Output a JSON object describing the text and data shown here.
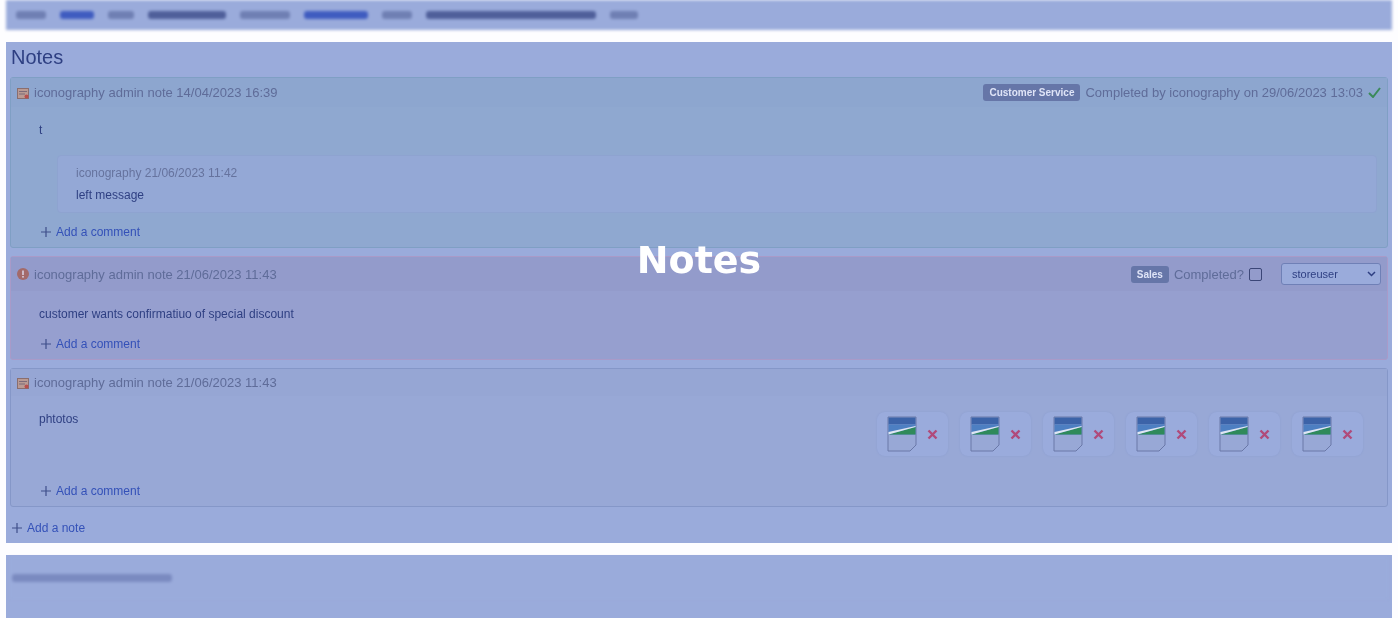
{
  "overlay_label": "Notes",
  "notes_panel": {
    "title": "Notes",
    "add_note": "Add a note",
    "notes": [
      {
        "kind": "note",
        "header": "iconography admin note 14/04/2023 16:39",
        "tag": "Customer Service",
        "completed": true,
        "completed_text": "Completed by iconography on 29/06/2023 13:03",
        "body": "t",
        "comments": [
          {
            "meta": "iconography 21/06/2023 11:42",
            "text": "left message"
          }
        ],
        "add_comment": "Add a comment"
      },
      {
        "kind": "alert",
        "header": "iconography admin note 21/06/2023 11:43",
        "tag": "Sales",
        "completed": false,
        "completed_label": "Completed?",
        "assignee": "storeuser",
        "body": "customer wants confirmatiuo of special discount",
        "add_comment": "Add a comment"
      },
      {
        "kind": "note",
        "header": "iconography admin note 21/06/2023 11:43",
        "body": "phtotos",
        "attachments": [
          {
            "kind": "image"
          },
          {
            "kind": "image"
          },
          {
            "kind": "image"
          },
          {
            "kind": "image"
          },
          {
            "kind": "image"
          },
          {
            "kind": "image"
          }
        ],
        "add_comment": "Add a comment"
      }
    ]
  }
}
